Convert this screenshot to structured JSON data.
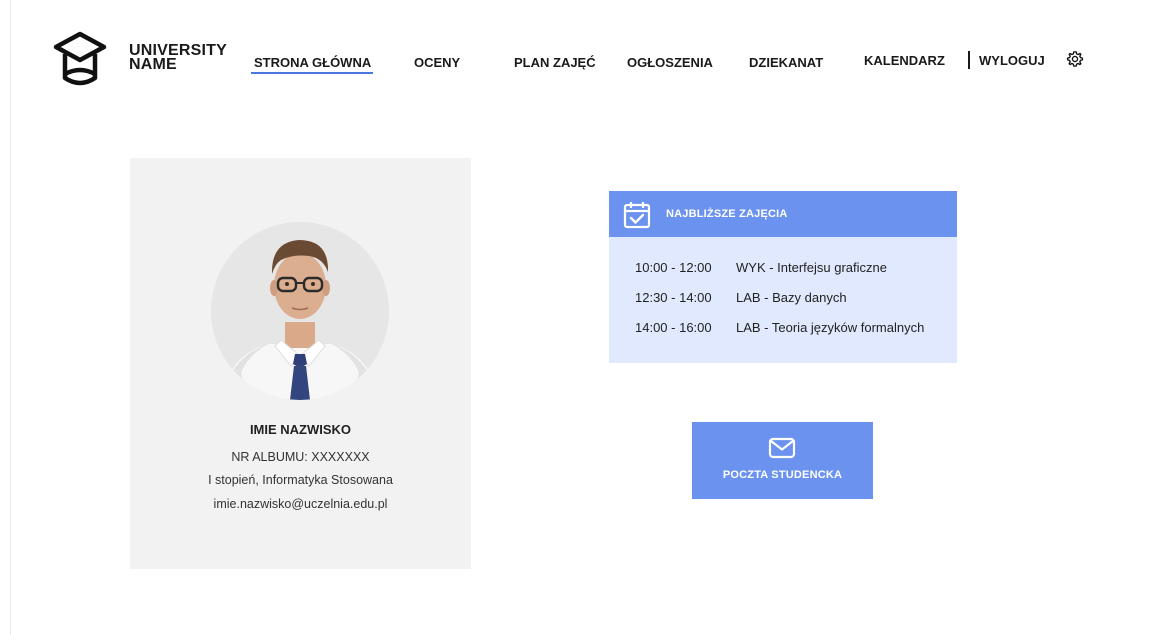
{
  "header": {
    "logo_line1": "UNIVERSITY",
    "logo_line2": "NAME",
    "nav": [
      {
        "label": "STRONA GŁÓWNA",
        "active": true
      },
      {
        "label": "OCENY"
      },
      {
        "label": "PLAN ZAJĘĆ"
      },
      {
        "label": "OGŁOSZENIA"
      },
      {
        "label": "DZIEKANAT"
      },
      {
        "label": "KALENDARZ"
      }
    ],
    "logout": "WYLOGUJ",
    "settings_icon": "gear-icon"
  },
  "profile": {
    "name": "IMIE NAZWISKO",
    "album": "NR ALBUMU: XXXXXXX",
    "program": "I stopień, Informatyka Stosowana",
    "email": "imie.nazwisko@uczelnia.edu.pl"
  },
  "schedule": {
    "title": "NAJBLIŻSZE ZAJĘCIA",
    "icon": "calendar-check-icon",
    "items": [
      {
        "time": "10:00 - 12:00",
        "subject": "WYK - Interfejsu graficzne"
      },
      {
        "time": "12:30 - 14:00",
        "subject": "LAB - Bazy danych"
      },
      {
        "time": "14:00 - 16:00",
        "subject": "LAB - Teoria języków formalnych"
      }
    ]
  },
  "mail": {
    "label": "POCZTA STUDENCKA",
    "icon": "envelope-icon"
  },
  "colors": {
    "accent": "#6a92ee",
    "accent_light": "#e0e9fd",
    "card_bg": "#f2f2f2",
    "underline": "#4a78e0"
  }
}
